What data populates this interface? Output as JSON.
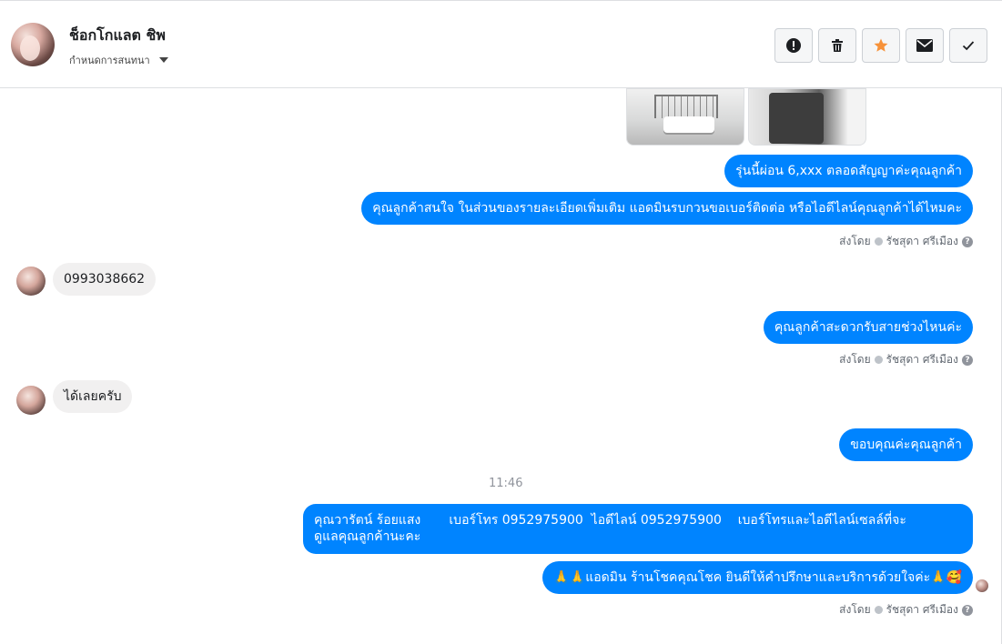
{
  "header": {
    "contact_name": "ช็อกโกแลต ชิพ",
    "thread_settings_label": "กำหนดการสนทนา",
    "actions": [
      {
        "icon": "alert-icon"
      },
      {
        "icon": "trash-icon"
      },
      {
        "icon": "star-icon",
        "color": "#f7923a"
      },
      {
        "icon": "envelope-icon"
      },
      {
        "icon": "check-icon"
      }
    ]
  },
  "messages": [
    {
      "side": "out",
      "text": "รุ่นนี้ผ่อน 6,xxx ตลอดสัญญาค่ะคุณลูกค้า"
    },
    {
      "side": "out",
      "text": "คุณลูกค้าสนใจ ในส่วนของรายละเอียดเพิ่มเติม แอดมินรบกวนขอเบอร์ติดต่อ หรือไอดีไลน์คุณลูกค้าได้ไหมคะ"
    },
    {
      "side": "in",
      "text": "0993038662"
    },
    {
      "side": "out",
      "text": "คุณลูกค้าสะดวกรับสายช่วงไหนค่ะ"
    },
    {
      "side": "in",
      "text": "ได้เลยครับ"
    },
    {
      "side": "out",
      "text": "ขอบคุณค่ะคุณลูกค้า"
    },
    {
      "side": "out",
      "line1": "คุณวารัตน์ ร้อยแสง       เบอร์โทร 0952975900  ไอดีไลน์ 0952975900    เบอร์โทรและไอดีไลน์เซลล์ที่จะ",
      "line2": "ดูแลคุณลูกค้านะคะ"
    },
    {
      "side": "out",
      "text": "🙏🙏แอดมิน ร้านโชคคุณโชค ยินดีให้คำปรึกษาและบริการด้วยใจค่ะ🙏🥰"
    }
  ],
  "sent_by": {
    "prefix": "ส่งโดย",
    "name": "รัชสุดา ศรีเมือง",
    "help": "?"
  },
  "timestamp": "11:46"
}
